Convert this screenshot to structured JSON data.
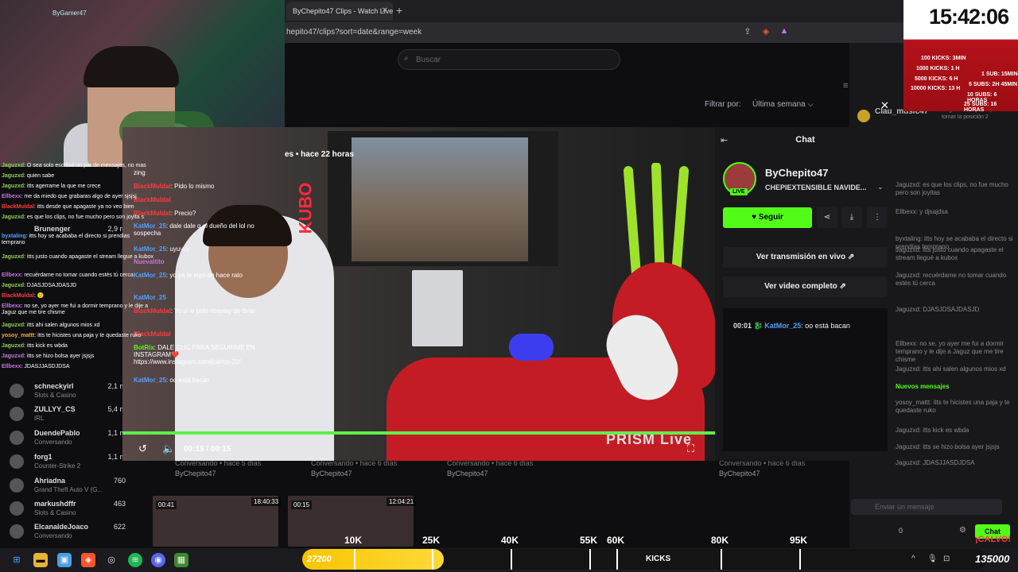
{
  "browser": {
    "tab_title": "ByChepito47 Clips - Watch Live c",
    "url": "hepito47/clips?sort=date&range=week",
    "new_tab": "+",
    "tab_close": "✕"
  },
  "page": {
    "search_placeholder": "Buscar",
    "filter_label": "Filtrar por:",
    "filter_value": "Última semana ⌵"
  },
  "webcam": {
    "logo": "ByGamer47"
  },
  "overlay_chat": [
    {
      "user": "Jaguzxd",
      "text": "O sea solo escribió un par de mensajes, no mas"
    },
    {
      "user": "Jaguzxd",
      "text": "quien sabe"
    },
    {
      "user": "Jaguzxd",
      "text": "itts agerrame la que me crece"
    },
    {
      "user": "Ellbexx",
      "text": "me da miedo que grabaras algo de ayer sjsjsj"
    },
    {
      "user": "BlackMuldal",
      "text": "itts desde que apagaste ya no veo bien"
    },
    {
      "user": "Jaguzxd",
      "text": "es que los clips, no fue mucho pero son joyita s"
    },
    {
      "user": "byxtaling",
      "text": "itts hoy se acababa el directo si prendias temprano"
    },
    {
      "user": "Jaguzxd",
      "text": "itts justo cuando apagaste el stream llegue a kubox"
    },
    {
      "user": "Ellbexx",
      "text": "recuérdame no tomar cuando estés tú cerca"
    },
    {
      "user": "Jaguzxd",
      "text": "DJASJDSAJDASJD"
    },
    {
      "user": "BlackMuldal",
      "text": "🙂"
    },
    {
      "user": "Ellbexx",
      "text": "no se, yo ayer me fui a dormir temprano y le dije a Jaguz que me tire chisme"
    },
    {
      "user": "Jaguzxd",
      "text": "itts ahi salen algunos mios xd"
    },
    {
      "user": "yosoy_mattt",
      "text": "itts te hicistes una paja y te quedaste ruko"
    },
    {
      "user": "Jaguzxd",
      "text": "itts kick es wbda"
    },
    {
      "user": "Jaguzxd",
      "text": "itts se hizo bolsa ayer jsjsjs"
    },
    {
      "user": "Ellbexx",
      "text": "JDASJJASDJDSA"
    }
  ],
  "sidebar": [
    {
      "name": "Brunenger",
      "game": "",
      "count": "2,9 m"
    },
    {
      "name": "schneckyirl",
      "game": "Slots & Casino",
      "count": "2,1 m"
    },
    {
      "name": "ZULLYY_CS",
      "game": "IRL",
      "count": "5,4 m"
    },
    {
      "name": "DuendePablo",
      "game": "Conversando",
      "count": "1,1 m"
    },
    {
      "name": "forg1",
      "game": "Counter-Strike 2",
      "count": "1,1 m"
    },
    {
      "name": "Ahriadna",
      "game": "Grand Theft Auto V (G...",
      "count": "760"
    },
    {
      "name": "markushdffr",
      "game": "Slots & Casino",
      "count": "463"
    },
    {
      "name": "ElcanaldeJoaco",
      "game": "Conversando",
      "count": "622"
    }
  ],
  "video": {
    "title": "es • hace 22 horas",
    "time": "00:15 / 00:15",
    "watermark": "PRISM Live",
    "sign_text": "KUBO"
  },
  "video_chat": [
    {
      "user": "",
      "text": "zing"
    },
    {
      "user": "BlackMuldal",
      "text": "Pido lo mismo"
    },
    {
      "user": "BlackMuldal",
      "text": ""
    },
    {
      "user": "BlackMuldal",
      "text": "Precio?"
    },
    {
      "user": "KatMor_25",
      "text": "dale dale q el dueño del lol no sospecha"
    },
    {
      "user": "KatMor_25",
      "text": "uyuyuy"
    },
    {
      "user": "Nuevaltito",
      "text": ""
    },
    {
      "user": "KatMor_25",
      "text": "yo ya te sigo de hace rato"
    },
    {
      "user": "KatMor_25",
      "text": ""
    },
    {
      "user": "BlackMuldal",
      "text": "Yo si le pido cosplay de Briar"
    },
    {
      "user": "BlackMuldal",
      "text": ""
    },
    {
      "user": "BotRix",
      "text": "DALE CLIC PARA SEGUIRME EN INSTAGRAM❤️ https://www.instagram.com/jcarlos-22/"
    },
    {
      "user": "KatMor_25",
      "text": "oo está bacan"
    }
  ],
  "modal": {
    "chat_title": "Chat",
    "channel": "ByChepito47",
    "subtitle": "CHEPIEXTENSIBLE NAVIDE...",
    "live_badge": "LIVE",
    "follow": "♥  Seguir",
    "watch_live": "Ver transmisión en vivo ⇗",
    "watch_full": "Ver video completo ⇗",
    "message": {
      "time": "00:01",
      "user": "KatMor_25",
      "text": ": oo está bacan"
    },
    "close": "✕"
  },
  "background_clips": [
    {
      "meta": "Conversando • hace 5 días",
      "owner": "ByChepito47"
    },
    {
      "meta": "Conversando • hace 6 días",
      "owner": "ByChepito47"
    },
    {
      "meta": "Conversando • hace 6 días",
      "owner": "ByChepito47"
    },
    {
      "meta": "Conversando • hace 6 días",
      "owner": "ByChepito47"
    }
  ],
  "thumbs": [
    {
      "dur": "00:41",
      "stamp": "18:40:33"
    },
    {
      "dur": "00:15",
      "stamp": "12:04:21"
    }
  ],
  "right_chat": {
    "top_user": "Clau_music47",
    "top_info": "Regala suscripción para tomar la posición 2",
    "lines": [
      "Jaguzxd: es que los clips, no fue mucho pero son joyitas",
      "Ellbexx: y djsajdsa",
      "byxtaling: itts hoy se acababa el directo si prendías temprano",
      "Jaguzxd: itts justo cuando apagaste el stream llegué a kubox",
      "Jaguzxd: recuérdame no tomar cuando estés tú cerca",
      "Jaguzxd: DJASJDSAJDASJD",
      "Ellbexx: no se, yo ayer me fui a dormir temprano y le dije a Jaguz que me tire chisme",
      "Jaguzxd: itts ahi salen algunos mios xd"
    ],
    "new_messages": "Nuevos mensajes",
    "after_lines": [
      "yosoy_mattt: itts te hicistes una paja y te quedaste ruko",
      "Jaguzxd: itts kick es wbda",
      "Jaguzxd: itts se hizo bolsa ayer jsjsjs",
      "Jaguzxd: JDASJJASDJDSA"
    ],
    "input_placeholder": "Enviar un mensaje",
    "chat_button": "Chat",
    "counter": "0"
  },
  "clock": {
    "time": "15:42:06",
    "rules": [
      "100 KICKS: 3MIN",
      "1000 KICKS: 1 H",
      "5000 KICKS: 6 H",
      "10000 KICKS: 13 H",
      "1 SUB: 15MIN",
      "5 SUBS: 2H 45MIN",
      "10 SUBS: 6 HORAS",
      "25 SUBS: 16 HORAS"
    ]
  },
  "goal": {
    "current": "27200",
    "progress_fraction": 0.207,
    "milestones": [
      {
        "label": "10K",
        "pct": 0.076
      },
      {
        "label": "25K",
        "pct": 0.19
      },
      {
        "label": "40K",
        "pct": 0.305
      },
      {
        "label": "55K",
        "pct": 0.42
      },
      {
        "label": "60K",
        "pct": 0.459
      },
      {
        "label": "80K",
        "pct": 0.612
      },
      {
        "label": "95K",
        "pct": 0.727
      }
    ],
    "kicks_label": "KICKS",
    "total": "135000",
    "calvo": "¡CALVO!"
  },
  "colors": {
    "kick_green": "#53fc18",
    "goal_yellow": "#f7c600",
    "santa_red": "#c41c24"
  }
}
